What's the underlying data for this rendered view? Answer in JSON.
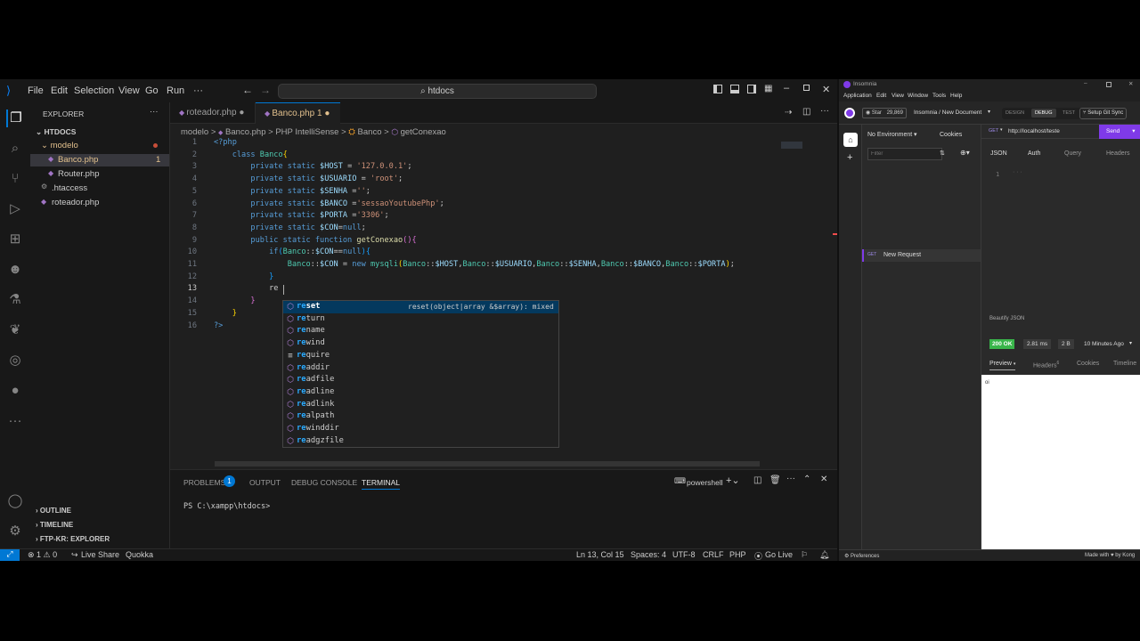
{
  "vscode": {
    "menu": [
      "File",
      "Edit",
      "Selection",
      "View",
      "Go",
      "Run",
      "···"
    ],
    "search_text": "htdocs",
    "explorer": {
      "title": "EXPLORER",
      "more": "···",
      "root": "HTDOCS",
      "folder": "modelo",
      "files": [
        {
          "name": "Banco.php",
          "badge": "1"
        },
        {
          "name": "Router.php",
          "badge": ""
        }
      ],
      "root_files": [
        ".htaccess",
        "roteador.php"
      ],
      "sections": [
        "OUTLINE",
        "TIMELINE",
        "FTP-KR: EXPLORER"
      ]
    },
    "tabs": [
      {
        "label": "roteador.php",
        "suffix": "●"
      },
      {
        "label": "Banco.php",
        "suffix": "1 ●"
      }
    ],
    "breadcrumb": [
      "modelo",
      ">",
      "Banco.php",
      ">",
      "PHP IntelliSense",
      ">",
      "Banco",
      ">",
      "getConexao"
    ],
    "code_lines": [
      {
        "n": "1",
        "html": "<span class='tag'>&lt;?php</span>"
      },
      {
        "n": "2",
        "html": "    <span class='kw'>class</span> <span class='cls'>Banco</span><span class='br'>{</span>"
      },
      {
        "n": "3",
        "html": "        <span class='kw'>private static</span> <span class='var'>$HOST</span> = <span class='str'>'127.0.0.1'</span>;"
      },
      {
        "n": "4",
        "html": "        <span class='kw'>private static</span> <span class='var'>$USUARIO</span> = <span class='str'>'root'</span>;"
      },
      {
        "n": "5",
        "html": "        <span class='kw'>private static</span> <span class='var'>$SENHA</span> =<span class='str'>''</span>;"
      },
      {
        "n": "6",
        "html": "        <span class='kw'>private static</span> <span class='var'>$BANCO</span> =<span class='str'>'sessaoYoutubePhp'</span>;"
      },
      {
        "n": "7",
        "html": "        <span class='kw'>private static</span> <span class='var'>$PORTA</span> =<span class='str'>'3306'</span>;"
      },
      {
        "n": "8",
        "html": "        <span class='kw'>private static</span> <span class='var'>$CON</span>=<span class='kw'>null</span>;"
      },
      {
        "n": "9",
        "html": "        <span class='kw'>public static function</span> <span class='fn'>getConexao</span><span class='br2'>()</span><span class='br2'>{</span>"
      },
      {
        "n": "10",
        "html": "            <span class='kw'>if</span><span class='br3'>(</span><span class='cls'>Banco</span>::<span class='var'>$CON</span>==<span class='kw'>null</span><span class='br3'>)</span><span class='br3'>{</span>"
      },
      {
        "n": "11",
        "html": "                <span class='cls'>Banco</span>::<span class='var'>$CON</span> = <span class='kw'>new</span> <span class='cls'>mysqli</span><span class='br'>(</span><span class='cls'>Banco</span>::<span class='var'>$HOST</span>,<span class='cls'>Banco</span>::<span class='var'>$USUARIO</span>,<span class='cls'>Banco</span>::<span class='var'>$SENHA</span>,<span class='cls'>Banco</span>::<span class='var'>$BANCO</span>,<span class='cls'>Banco</span>::<span class='var'>$PORTA</span><span class='br'>)</span>;"
      },
      {
        "n": "12",
        "html": "            <span class='br3'>}</span>"
      },
      {
        "n": "13",
        "html": "            re"
      },
      {
        "n": "14",
        "html": "        <span class='br2'>}</span>"
      },
      {
        "n": "15",
        "html": "    <span class='br'>}</span>"
      },
      {
        "n": "16",
        "html": "<span class='tag'>?&gt;</span>"
      }
    ],
    "suggestions": [
      {
        "match": "re",
        "rest": "set",
        "detail": "reset(object|array &$array): mixed"
      },
      {
        "match": "re",
        "rest": "turn",
        "detail": ""
      },
      {
        "match": "re",
        "rest": "name",
        "detail": ""
      },
      {
        "match": "re",
        "rest": "wind",
        "detail": ""
      },
      {
        "match": "re",
        "rest": "quire",
        "detail": ""
      },
      {
        "match": "re",
        "rest": "addir",
        "detail": ""
      },
      {
        "match": "re",
        "rest": "adfile",
        "detail": ""
      },
      {
        "match": "re",
        "rest": "adline",
        "detail": ""
      },
      {
        "match": "re",
        "rest": "adlink",
        "detail": ""
      },
      {
        "match": "re",
        "rest": "alpath",
        "detail": ""
      },
      {
        "match": "re",
        "rest": "winddir",
        "detail": ""
      },
      {
        "match": "re",
        "rest": "adgzfile",
        "detail": ""
      }
    ],
    "panel": {
      "tabs": [
        "PROBLEMS",
        "OUTPUT",
        "DEBUG CONSOLE",
        "TERMINAL"
      ],
      "problems_count": "1",
      "shell": "powershell",
      "prompt": "PS C:\\xampp\\htdocs>"
    },
    "status": {
      "errors": "⊗ 1 ⚠ 0",
      "live_share": "Live Share",
      "quokka": "Quokka",
      "position": "Ln 13, Col 15",
      "spaces": "Spaces: 4",
      "encoding": "UTF-8",
      "eol": "CRLF",
      "language": "PHP",
      "go_live": "Go Live"
    }
  },
  "insomnia": {
    "window_title": "Insomnia",
    "menu": [
      "Application",
      "Edit",
      "View",
      "Window",
      "Tools",
      "Help"
    ],
    "star_label": "Star",
    "star_count": "29,869",
    "breadcrumb": "Insomnia / New Document",
    "modes": [
      "DESIGN",
      "DEBUG",
      "TEST"
    ],
    "git_sync": "Setup Git Sync",
    "environment": "No Environment",
    "cookies": "Cookies",
    "filter_placeholder": "Filter",
    "request_method": "GET",
    "request_name": "New Request",
    "url_method": "GET",
    "url": "http://localhost/teste",
    "send": "Send",
    "req_tabs": [
      "JSON",
      "Auth",
      "Query",
      "Headers"
    ],
    "body_line": "1",
    "beautify": "Beautify JSON",
    "status_code": "200 OK",
    "time": "2.81 ms",
    "size": "2 B",
    "ago": "10 Minutes Ago",
    "resp_tabs": [
      "Preview",
      "Headers",
      "Cookies",
      "Timeline"
    ],
    "headers_count": "6",
    "response_body": "oi",
    "preferences": "Preferences",
    "made_with": "Made with ♥ by Kong"
  },
  "colors": {
    "accent": "#0078d4",
    "insomnia_purple": "#7f3ae8",
    "status_ok": "#39b54a"
  }
}
